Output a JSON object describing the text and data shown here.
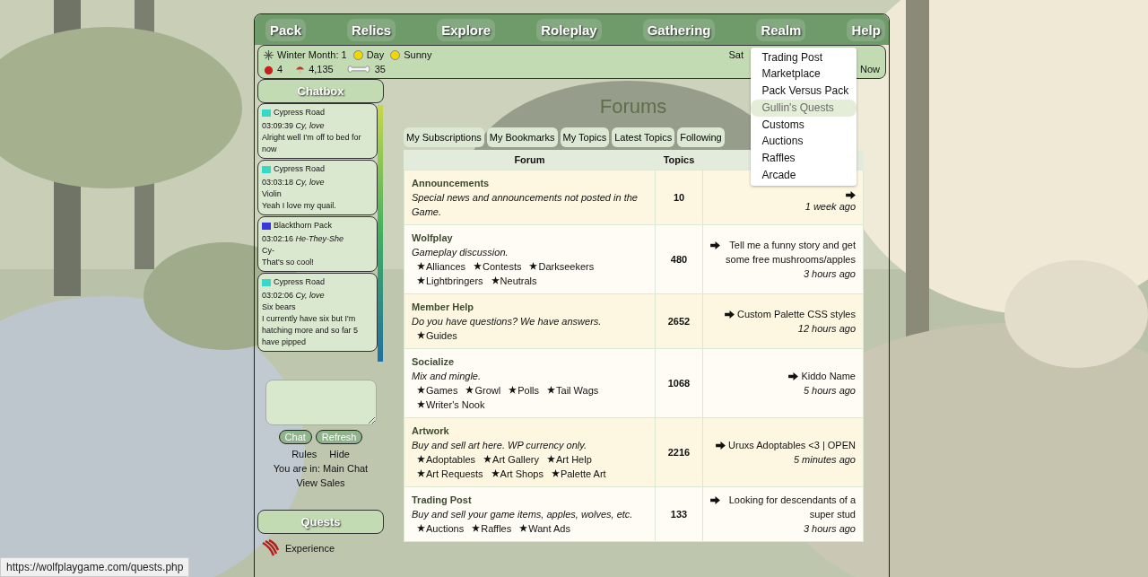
{
  "nav": [
    {
      "label": "Pack"
    },
    {
      "label": "Relics"
    },
    {
      "label": "Explore"
    },
    {
      "label": "Roleplay"
    },
    {
      "label": "Gathering"
    },
    {
      "label": "Realm",
      "menu": [
        {
          "label": "Trading Post",
          "selected": false
        },
        {
          "label": "Marketplace",
          "selected": false
        },
        {
          "label": "Pack Versus Pack",
          "selected": false
        },
        {
          "label": "Gullin's Quests",
          "selected": true
        },
        {
          "label": "Customs",
          "selected": false
        },
        {
          "label": "Auctions",
          "selected": false
        },
        {
          "label": "Raffles",
          "selected": false
        },
        {
          "label": "Arcade",
          "selected": false
        }
      ]
    },
    {
      "label": "Help"
    }
  ],
  "info": {
    "season": "Winter Month: 1",
    "time": "Day",
    "weather": "Sunny",
    "apples": "4",
    "mushrooms": "4,135",
    "bones": "35",
    "right_top": "Sat",
    "right_bottom": "Now"
  },
  "chatbox": {
    "title": "Chatbox",
    "messages": [
      {
        "pack": "Cypress Road",
        "color": "#38d8c8",
        "time": "03:09:39",
        "author": "Cy, love",
        "lines": [
          "Alright well I'm off to bed for now"
        ]
      },
      {
        "pack": "Cypress Road",
        "color": "#38d8c8",
        "time": "03:03:18",
        "author": "Cy, love",
        "lines": [
          "Violin",
          "Yeah I love my quail."
        ]
      },
      {
        "pack": "Blackthorn Pack",
        "color": "#3838d8",
        "time": "03:02:16",
        "author": "He-They-She",
        "lines": [
          "Cy-",
          "That's so cool!"
        ]
      },
      {
        "pack": "Cypress Road",
        "color": "#38d8c8",
        "time": "03:02:06",
        "author": "Cy, love",
        "lines": [
          "Six bears",
          "I currently have six but I'm hatching more and so far 5 have pipped"
        ]
      }
    ],
    "buttons": [
      "Chat",
      "Refresh"
    ],
    "links": [
      "Rules",
      "Hide"
    ],
    "room": "You are in: Main Chat",
    "sales": "View Sales"
  },
  "quests": {
    "title": "Quests",
    "items": [
      "Experience"
    ]
  },
  "forums": {
    "title": "Forums",
    "tabs": [
      "My Subscriptions",
      "My Bookmarks",
      "My Topics",
      "Latest Topics",
      "Following"
    ],
    "columns": [
      "Forum",
      "Topics"
    ],
    "rows": [
      {
        "name": "Announcements",
        "desc": "Special news and announcements not posted in the Game.",
        "subs": [],
        "topics": "10",
        "ago": "1 week ago"
      },
      {
        "name": "Wolfplay",
        "desc": "Gameplay discussion.",
        "subs": [
          "Alliances",
          "Contests",
          "Darkseekers",
          "Lightbringers",
          "Neutrals"
        ],
        "topics": "480",
        "last": "Tell me a funny story and get some free mushrooms/apples",
        "ago": "3 hours ago"
      },
      {
        "name": "Member Help",
        "desc": "Do you have questions? We have answers.",
        "subs": [
          "Guides"
        ],
        "topics": "2652",
        "last": "Custom Palette CSS styles",
        "ago": "12 hours ago"
      },
      {
        "name": "Socialize",
        "desc": "Mix and mingle.",
        "subs": [
          "Games",
          "Growl",
          "Polls",
          "Tail Wags",
          "Writer's Nook"
        ],
        "topics": "1068",
        "last": "Kiddo Name",
        "ago": "5 hours ago"
      },
      {
        "name": "Artwork",
        "desc": "Buy and sell art here. WP currency only.",
        "subs": [
          "Adoptables",
          "Art Gallery",
          "Art Help",
          "Art Requests",
          "Art Shops",
          "Palette Art"
        ],
        "topics": "2216",
        "last": "Uruxs Adoptables <3 | OPEN",
        "ago": "5 minutes ago"
      },
      {
        "name": "Trading Post",
        "desc": "Buy and sell your game items, apples, wolves, etc.",
        "subs": [
          "Auctions",
          "Raffles",
          "Want Ads"
        ],
        "topics": "133",
        "last": "Looking for descendants of a super stud",
        "ago": "3 hours ago"
      }
    ]
  },
  "status_url": "https://wolfplaygame.com/quests.php"
}
